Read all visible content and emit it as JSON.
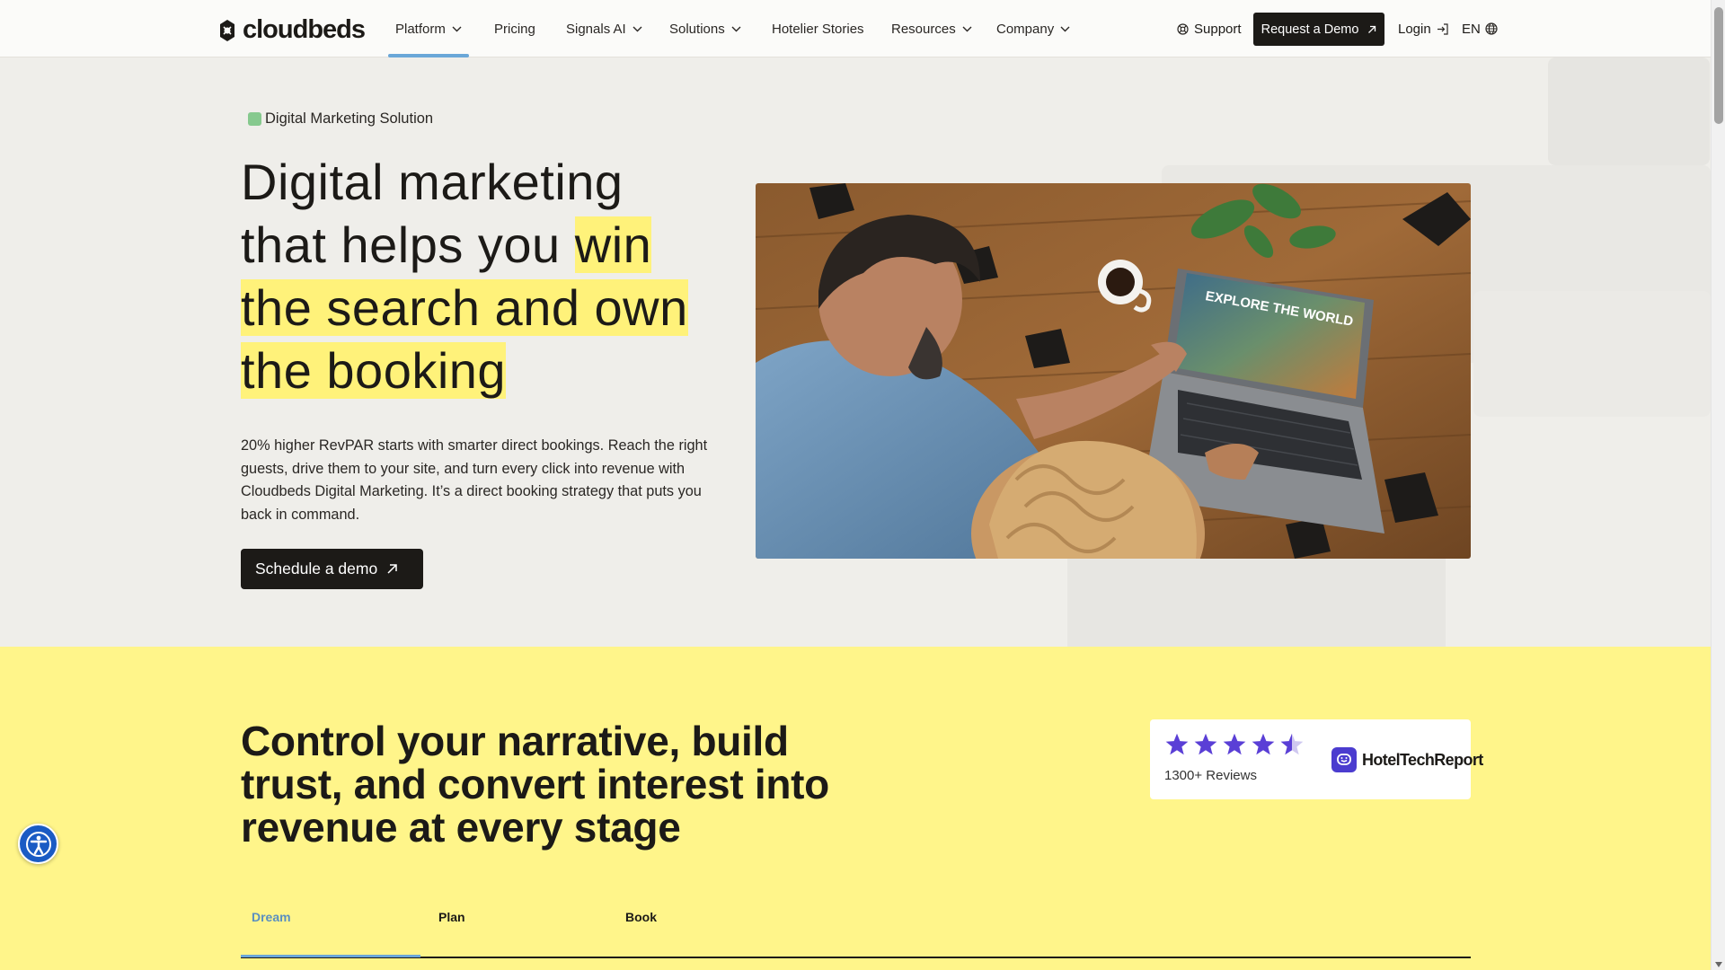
{
  "brand": {
    "name": "cloudbeds"
  },
  "nav": {
    "items": [
      {
        "label": "Platform",
        "dropdown": true,
        "active": true
      },
      {
        "label": "Pricing",
        "dropdown": false
      },
      {
        "label": "Signals AI",
        "dropdown": true
      },
      {
        "label": "Solutions",
        "dropdown": true
      },
      {
        "label": "Hotelier Stories",
        "dropdown": false
      },
      {
        "label": "Resources",
        "dropdown": true
      },
      {
        "label": "Company",
        "dropdown": true
      }
    ],
    "support_label": "Support",
    "demo_label": "Request a Demo",
    "login_label": "Login",
    "lang_label": "EN"
  },
  "hero": {
    "badge": "Digital Marketing Solution",
    "headline_plain_1": "Digital marketing",
    "headline_plain_2": "that helps you",
    "headline_hl_1": "win",
    "headline_hl_2": "the search and own",
    "headline_hl_3": "the booking",
    "description": "20% higher RevPAR starts with smarter direct bookings. Reach the right guests, drive them to your site, and turn every click into revenue with Cloudbeds Digital Marketing. It’s a direct booking strategy that puts you back in command.",
    "cta_label": "Schedule a demo",
    "laptop_screen_text": "EXPLORE THE WORLD"
  },
  "section2": {
    "title": "Control your narrative, build trust, and convert interest into revenue at every stage",
    "rating": {
      "stars": 4.5,
      "max": 5,
      "reviews_label": "1300+ Reviews",
      "source": "HotelTechReport"
    },
    "tabs": [
      {
        "label": "Dream",
        "active": true
      },
      {
        "label": "Plan",
        "active": false
      },
      {
        "label": "Book",
        "active": false
      }
    ]
  },
  "colors": {
    "accent_blue": "#6aa7d8",
    "highlight_yellow": "#fff27a",
    "section_yellow": "#fff58a",
    "dark": "#1c1a17",
    "badge_green": "#86c98e",
    "star_purple": "#5a3fd6"
  }
}
